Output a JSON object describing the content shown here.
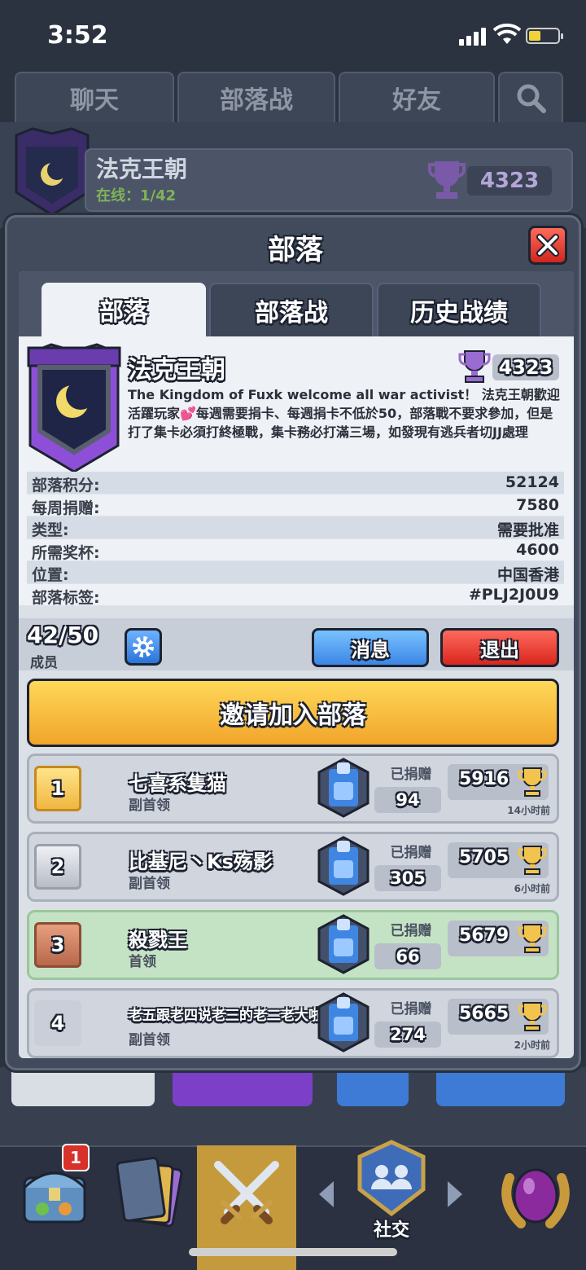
{
  "status": {
    "time": "3:52"
  },
  "background": {
    "tabs": [
      "聊天",
      "部落战",
      "好友"
    ],
    "clan_name": "法克王朝",
    "online": "在线：1/42",
    "trophies": "4323"
  },
  "modal": {
    "title": "部落",
    "tabs": [
      "部落",
      "部落战",
      "历史战绩"
    ],
    "clan": {
      "name": "法克王朝",
      "trophies": "4323",
      "description": "The Kingdom of Fuxk welcome all war activist！ 法克王朝歡迎活躍玩家💕每週需要捐卡、每週捐卡不低於50，部落戰不要求參加，但是打了集卡必須打終極戰，集卡務必打滿三場，如發現有逃兵者切JJ處理"
    },
    "stats": [
      {
        "label": "部落积分:",
        "value": "52124"
      },
      {
        "label": "每周捐赠:",
        "value": "7580"
      },
      {
        "label": "类型:",
        "value": "需要批准"
      },
      {
        "label": "所需奖杯:",
        "value": "4600"
      },
      {
        "label": "位置:",
        "value": "中国香港"
      },
      {
        "label": "部落标签:",
        "value": "#PLJ2J0U9"
      }
    ],
    "members_count": "42/50",
    "members_label": "成员",
    "buttons": {
      "message": "消息",
      "leave": "退出",
      "invite": "邀请加入部落"
    },
    "members": [
      {
        "rank": "1",
        "name": "七喜系隻猫",
        "role": "副首领",
        "donated_label": "已捐赠",
        "donated": "94",
        "trophies": "5916",
        "last_seen": "14小时前"
      },
      {
        "rank": "2",
        "name": "比基尼丶Ks殇影",
        "role": "副首领",
        "donated_label": "已捐赠",
        "donated": "305",
        "trophies": "5705",
        "last_seen": "6小时前"
      },
      {
        "rank": "3",
        "name": "殺戮王",
        "role": "首领",
        "donated_label": "已捐赠",
        "donated": "66",
        "trophies": "5679",
        "last_seen": ""
      },
      {
        "rank": "4",
        "name": "老五跟老四说老三的老二老大啦",
        "role": "副首领",
        "donated_label": "已捐赠",
        "donated": "274",
        "trophies": "5665",
        "last_seen": "2小时前"
      }
    ]
  },
  "nav": {
    "badge": "1",
    "social_label": "社交"
  }
}
